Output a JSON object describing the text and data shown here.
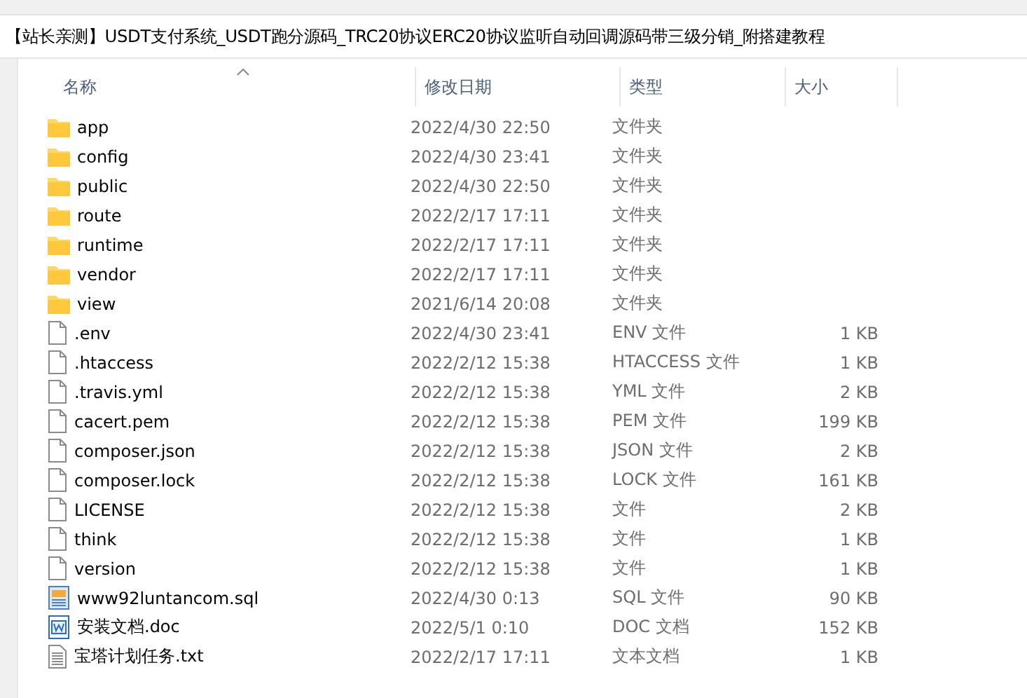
{
  "title": "【站长亲测】USDT支付系统_USDT跑分源码_TRC20协议ERC20协议监听自动回调源码带三级分销_附搭建教程",
  "columns": [
    {
      "label": "名称",
      "sorted": true
    },
    {
      "label": "修改日期",
      "sorted": false
    },
    {
      "label": "类型",
      "sorted": false
    },
    {
      "label": "大小",
      "sorted": false
    }
  ],
  "files": [
    {
      "kind": "folder",
      "name": "app",
      "date": "2022/4/30 22:50",
      "type": "文件夹"
    },
    {
      "kind": "folder",
      "name": "config",
      "date": "2022/4/30 23:41",
      "type": "文件夹"
    },
    {
      "kind": "folder",
      "name": "public",
      "date": "2022/4/30 22:50",
      "type": "文件夹"
    },
    {
      "kind": "folder",
      "name": "route",
      "date": "2022/2/17 17:11",
      "type": "文件夹"
    },
    {
      "kind": "folder",
      "name": "runtime",
      "date": "2022/2/17 17:11",
      "type": "文件夹"
    },
    {
      "kind": "folder",
      "name": "vendor",
      "date": "2022/2/17 17:11",
      "type": "文件夹"
    },
    {
      "kind": "folder",
      "name": "view",
      "date": "2021/6/14 20:08",
      "type": "文件夹"
    },
    {
      "kind": "file",
      "name": ".env",
      "date": "2022/4/30 23:41",
      "type": "ENV 文件",
      "size": "1 KB"
    },
    {
      "kind": "file",
      "name": ".htaccess",
      "date": "2022/2/12 15:38",
      "type": "HTACCESS 文件",
      "size": "1 KB"
    },
    {
      "kind": "file",
      "name": ".travis.yml",
      "date": "2022/2/12 15:38",
      "type": "YML 文件",
      "size": "2 KB"
    },
    {
      "kind": "file",
      "name": "cacert.pem",
      "date": "2022/2/12 15:38",
      "type": "PEM 文件",
      "size": "199 KB"
    },
    {
      "kind": "file",
      "name": "composer.json",
      "date": "2022/2/12 15:38",
      "type": "JSON 文件",
      "size": "2 KB"
    },
    {
      "kind": "file",
      "name": "composer.lock",
      "date": "2022/2/12 15:38",
      "type": "LOCK 文件",
      "size": "161 KB"
    },
    {
      "kind": "file",
      "name": "LICENSE",
      "date": "2022/2/12 15:38",
      "type": "文件",
      "size": "2 KB"
    },
    {
      "kind": "file",
      "name": "think",
      "date": "2022/2/12 15:38",
      "type": "文件",
      "size": "1 KB"
    },
    {
      "kind": "file",
      "name": "version",
      "date": "2022/2/12 15:38",
      "type": "文件",
      "size": "1 KB"
    },
    {
      "kind": "sql",
      "name": "www92luntancom.sql",
      "date": "2022/4/30 0:13",
      "type": "SQL 文件",
      "size": "90 KB"
    },
    {
      "kind": "doc",
      "name": "安装文档.doc",
      "date": "2022/5/1 0:10",
      "type": "DOC 文档",
      "size": "152 KB"
    },
    {
      "kind": "txt",
      "name": "宝塔计划任务.txt",
      "date": "2022/2/17 17:11",
      "type": "文本文档",
      "size": "1 KB"
    }
  ]
}
